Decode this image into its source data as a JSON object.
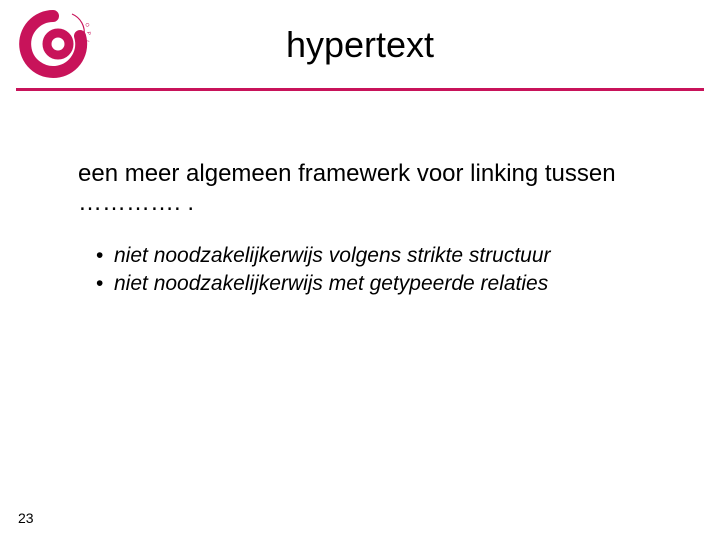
{
  "brand": {
    "accent": "#c8135a",
    "logo_label": "GO Opleidingen"
  },
  "title": "hypertext",
  "intro": "een meer algemeen framewerk voor linking tussen …………. .",
  "bullets": [
    "niet noodzakelijkerwijs volgens strikte structuur",
    "niet noodzakelijkerwijs met getypeerde relaties"
  ],
  "page_number": "23"
}
